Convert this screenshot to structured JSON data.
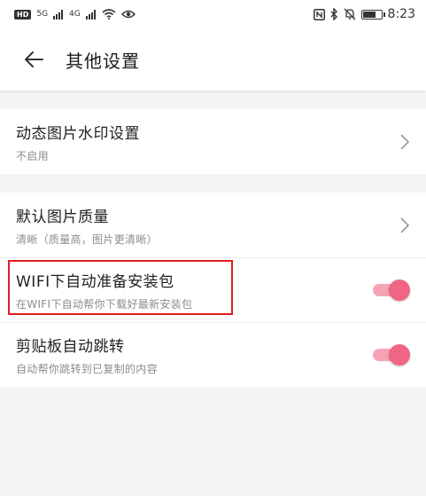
{
  "status_bar": {
    "hd_label": "HD",
    "net1_label": "5G",
    "net2_label": "4G",
    "time": "8:23",
    "icons": [
      "hd-icon",
      "signal-icon",
      "signal-icon",
      "wifi-icon",
      "eye-icon",
      "nfc-icon",
      "bluetooth-icon",
      "mute-icon",
      "battery-icon"
    ]
  },
  "header": {
    "title": "其他设置",
    "back_icon": "back-arrow-icon"
  },
  "settings": {
    "watermark": {
      "title": "动态图片水印设置",
      "subtitle": "不启用"
    },
    "image_quality": {
      "title": "默认图片质量",
      "subtitle": "清晰（质量高，图片更清晰）"
    },
    "wifi_download": {
      "title": "WIFI下自动准备安装包",
      "subtitle": "在WIFI下自动帮你下载好最新安装包",
      "enabled": true
    },
    "clipboard_jump": {
      "title": "剪贴板自动跳转",
      "subtitle": "自动帮你跳转到已复制的内容",
      "enabled": true
    }
  },
  "colors": {
    "accent": "#f06584",
    "accent_track": "#f7a3b6",
    "highlight_box": "#e01e1e",
    "background": "#f4f4f4"
  }
}
